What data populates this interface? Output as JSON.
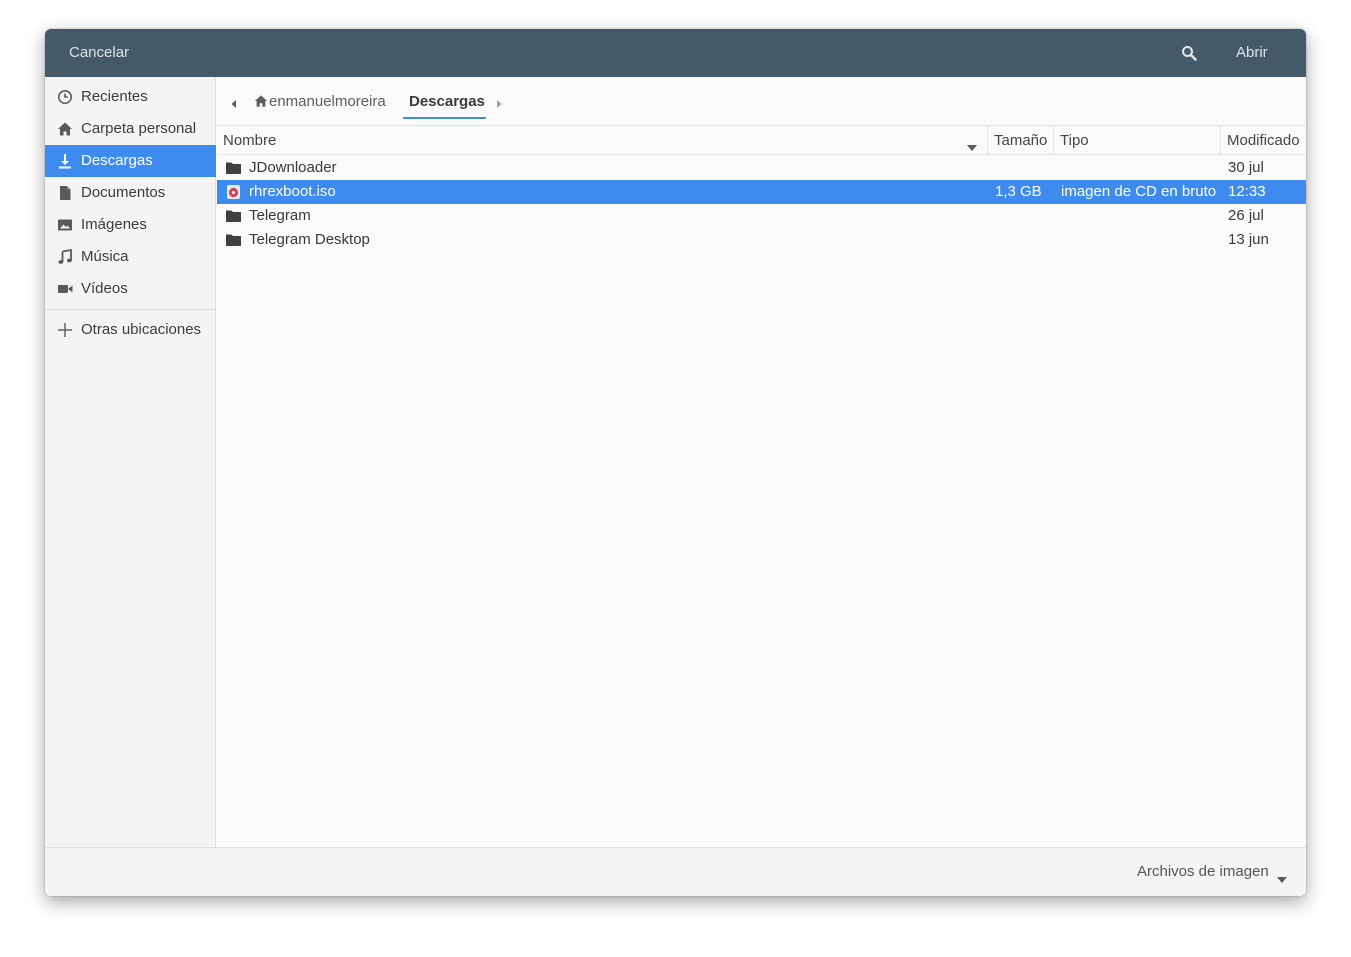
{
  "header": {
    "cancel_label": "Cancelar",
    "open_label": "Abrir",
    "search_icon": "search-icon",
    "background_color": "#455a68"
  },
  "sidebar": {
    "items": [
      {
        "label": "Recientes",
        "icon": "clock-icon"
      },
      {
        "label": "Carpeta personal",
        "icon": "home-icon"
      },
      {
        "label": "Descargas",
        "icon": "download-icon",
        "active": true
      },
      {
        "label": "Documentos",
        "icon": "document-icon"
      },
      {
        "label": "Imágenes",
        "icon": "image-icon"
      },
      {
        "label": "Música",
        "icon": "music-icon"
      },
      {
        "label": "Vídeos",
        "icon": "video-icon"
      }
    ],
    "other_locations": {
      "label": "Otras ubicaciones",
      "icon": "plus-icon"
    },
    "active_color": "#3d8bef"
  },
  "pathbar": {
    "home_label": "enmanuelmoreira",
    "current_label": "Descargas"
  },
  "columns": {
    "name": "Nombre",
    "size": "Tamaño",
    "type": "Tipo",
    "modified": "Modificado"
  },
  "files": [
    {
      "name": "JDownloader",
      "size": "",
      "type": "",
      "modified": "30 jul",
      "icon": "folder-icon"
    },
    {
      "name": "rhrexboot.iso",
      "size": "1,3 GB",
      "type": "imagen de CD en bruto",
      "modified": "12:33",
      "icon": "disc-image-icon",
      "selected": true
    },
    {
      "name": "Telegram",
      "size": "",
      "type": "",
      "modified": "26 jul",
      "icon": "folder-icon"
    },
    {
      "name": "Telegram Desktop",
      "size": "",
      "type": "",
      "modified": "13 jun",
      "icon": "folder-icon"
    }
  ],
  "footer": {
    "filter_label": "Archivos de imagen"
  }
}
